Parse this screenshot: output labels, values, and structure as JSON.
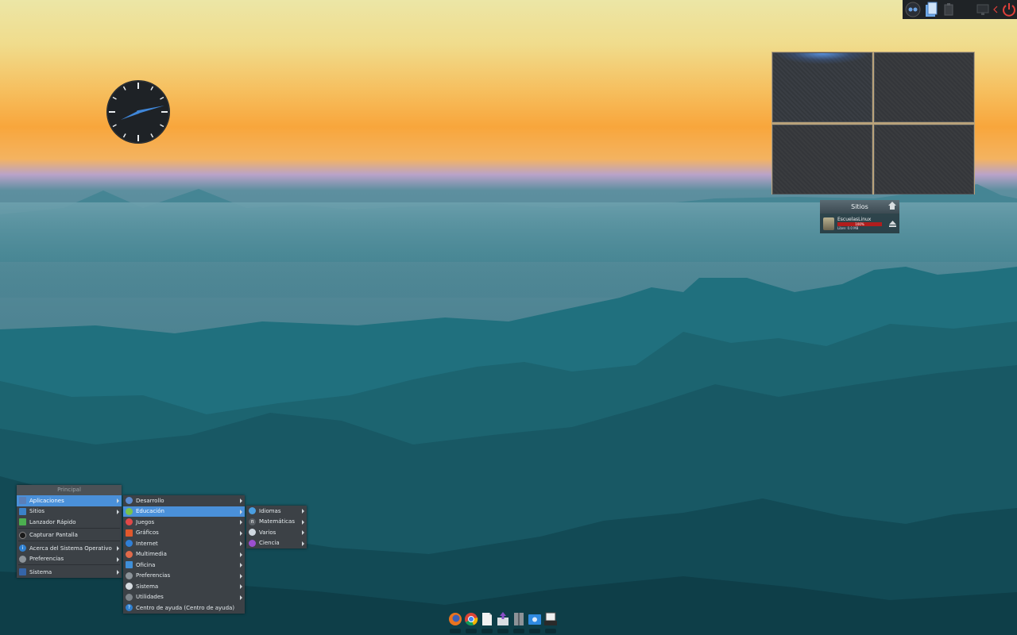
{
  "desktop": {
    "places_widget": {
      "title": "Sitios",
      "drive_name": "EscuelasLinux",
      "usage_percent_label": "100%",
      "usage_fraction": 1.0,
      "free_label": "Libre: 0.0 MB"
    }
  },
  "main_menu": {
    "title": "Principal",
    "items": [
      {
        "label": "Aplicaciones",
        "icon": "applications-icon",
        "selected": true,
        "submenu": true
      },
      {
        "label": "Sitios",
        "icon": "folder-icon",
        "submenu": true
      },
      {
        "label": "Lanzador Rápido",
        "icon": "launcher-icon",
        "submenu": false
      },
      {
        "label": "Capturar Pantalla",
        "icon": "screenshot-icon",
        "submenu": false
      },
      {
        "label": "Acerca del Sistema Operativo",
        "icon": "info-icon",
        "submenu": true
      },
      {
        "label": "Preferencias",
        "icon": "preferences-icon",
        "submenu": true
      },
      {
        "label": "Sistema",
        "icon": "system-icon",
        "submenu": true
      }
    ]
  },
  "apps_menu": {
    "items": [
      {
        "label": "Desarrollo",
        "icon": "development-icon"
      },
      {
        "label": "Educación",
        "icon": "education-icon",
        "selected": true
      },
      {
        "label": "Juegos",
        "icon": "games-icon"
      },
      {
        "label": "Gráficos",
        "icon": "graphics-icon"
      },
      {
        "label": "Internet",
        "icon": "internet-icon"
      },
      {
        "label": "Multimedia",
        "icon": "multimedia-icon"
      },
      {
        "label": "Oficina",
        "icon": "office-icon"
      },
      {
        "label": "Preferencias",
        "icon": "preferences-icon"
      },
      {
        "label": "Sistema",
        "icon": "system-icon"
      },
      {
        "label": "Utilidades",
        "icon": "utilities-icon"
      },
      {
        "label": "Centro de ayuda (Centro de ayuda)",
        "icon": "help-icon"
      }
    ]
  },
  "education_menu": {
    "items": [
      {
        "label": "Idiomas",
        "icon": "languages-icon"
      },
      {
        "label": "Matemáticas",
        "icon": "math-icon"
      },
      {
        "label": "Varios",
        "icon": "misc-icon"
      },
      {
        "label": "Ciencia",
        "icon": "science-icon"
      }
    ]
  },
  "dock": {
    "items": [
      "firefox-icon",
      "chrome-icon",
      "text-editor-icon",
      "install-icon",
      "archive-icon",
      "file-manager-icon",
      "scanner-icon"
    ]
  },
  "tray": {
    "items": [
      "user-icon",
      "files-icon",
      "clipboard-icon",
      "display-icon",
      "power-icon"
    ]
  },
  "colors": {
    "menu_bg": "#3c4146",
    "menu_highlight": "#4a90d9",
    "disk_bar": "#b11d1d",
    "power": "#e0403a"
  }
}
